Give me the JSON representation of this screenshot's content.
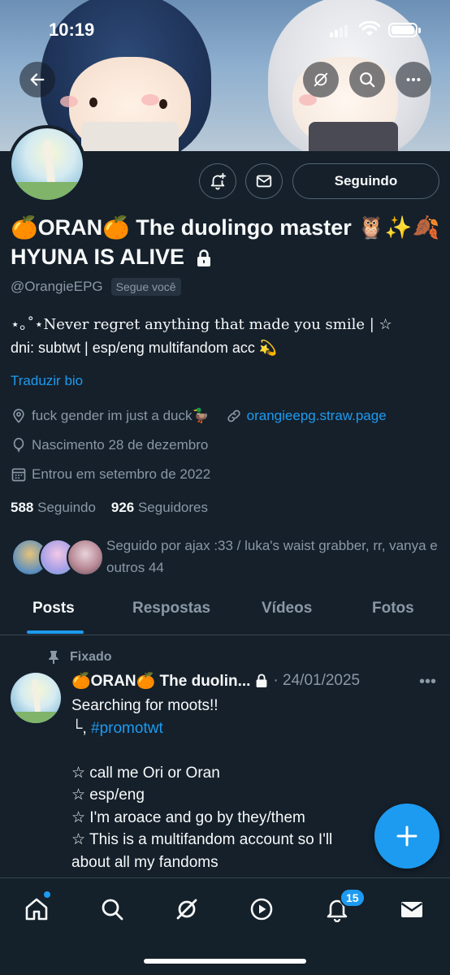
{
  "status_bar": {
    "time": "10:19",
    "battery_level": 0.9
  },
  "profile": {
    "display_name": "🍊ORAN🍊 The duolingo master 🦉✨🍂 HYUNA IS ALIVE",
    "handle": "@OrangieEPG",
    "follows_you": "Segue você",
    "bio_line1": "⋆｡˚⋆Never regret anything that made you smile | ☆",
    "bio_line2": "dni: subtwt | esp/eng multifandom acc 💫",
    "translate_bio": "Traduzir bio",
    "location": "fuck gender im just a duck🦆",
    "website": "orangieepg.straw.page",
    "birth": "Nascimento 28 de dezembro",
    "joined": "Entrou em setembro de 2022",
    "following_count": "588",
    "following_label": "Seguindo",
    "followers_count": "926",
    "followers_label": "Seguidores",
    "followed_by": "Seguido por ajax :33 / luka's waist grabber, rr, vanya e outros 44"
  },
  "actions": {
    "follow_label": "Seguindo"
  },
  "tabs": [
    {
      "label": "Posts",
      "active": true
    },
    {
      "label": "Respostas",
      "active": false
    },
    {
      "label": "Vídeos",
      "active": false
    },
    {
      "label": "Fotos",
      "active": false
    }
  ],
  "pinned_post": {
    "pinned_label": "Fixado",
    "author": "🍊ORAN🍊 The duolin...",
    "date": "· 24/01/2025",
    "line1": "Searching for moots!!",
    "hashtag_prefix": "└, ",
    "hashtag": "#promotwt",
    "body": "☆ call me Ori or Oran\n☆ esp/eng\n☆ I'm aroace and go by they/them\n☆ This is a multifandom account so I'll\nabout all my fandoms"
  },
  "nav": {
    "notifications_badge": "15"
  },
  "colors": {
    "background": "#15202b",
    "accent": "#1d9bf0",
    "muted": "#8b98a5",
    "border": "#38444d"
  }
}
